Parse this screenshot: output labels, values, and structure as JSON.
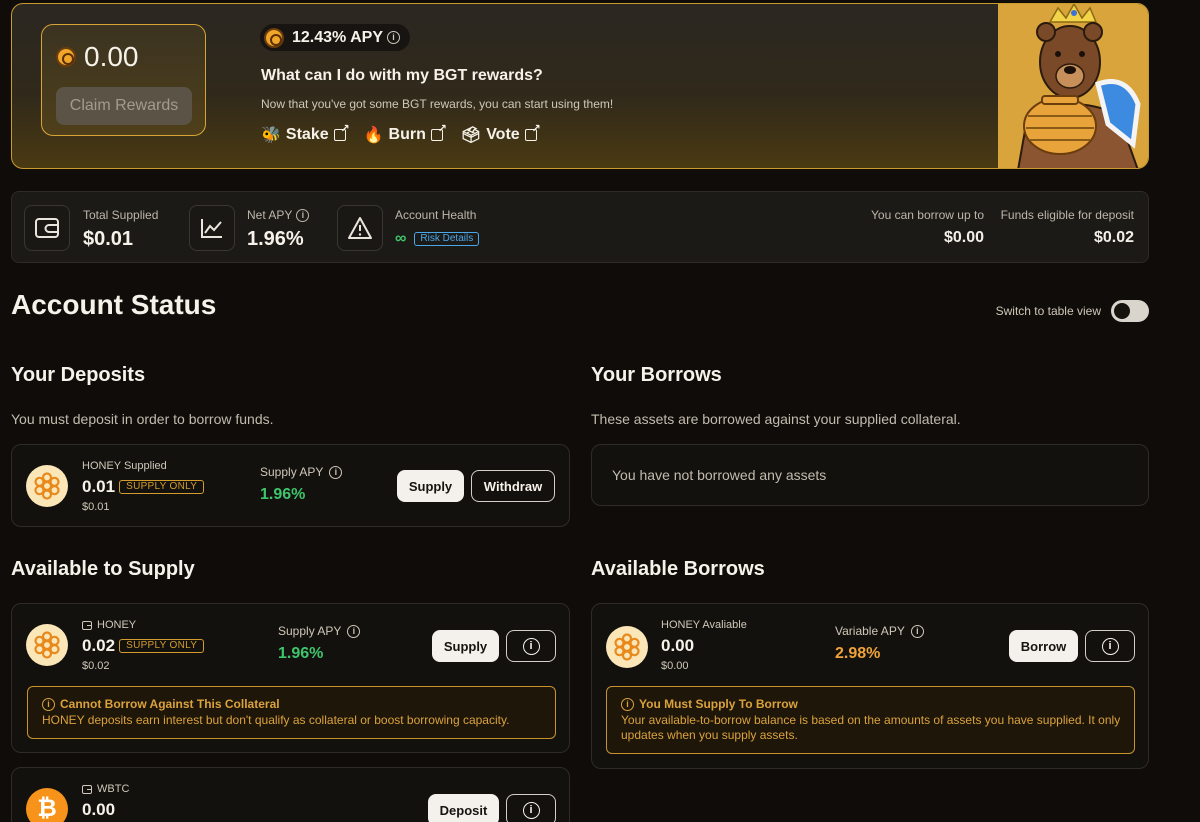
{
  "rewards": {
    "balance": "0.00",
    "claim_label": "Claim Rewards",
    "apy": "12.43% APY",
    "title": "What can I do with my BGT rewards?",
    "subtitle": "Now that you've got some BGT rewards, you can start using them!",
    "links": [
      {
        "emoji": "🐝",
        "label": "Stake"
      },
      {
        "emoji": "🔥",
        "label": "Burn"
      },
      {
        "emoji": "🗳",
        "label": "Vote"
      }
    ]
  },
  "stats": {
    "total_supplied_label": "Total Supplied",
    "total_supplied_value": "$0.01",
    "net_apy_label": "Net APY",
    "net_apy_value": "1.96%",
    "account_health_label": "Account Health",
    "account_health_value": "∞",
    "risk_details_label": "Risk Details",
    "borrow_up_to_label": "You can borrow up to",
    "borrow_up_to_value": "$0.00",
    "funds_eligible_label": "Funds eligible for deposit",
    "funds_eligible_value": "$0.02"
  },
  "account_status": {
    "title": "Account Status",
    "toggle_label": "Switch to table view"
  },
  "deposits": {
    "title": "Your Deposits",
    "subtitle": "You must deposit in order to borrow funds.",
    "item": {
      "label": "HONEY Supplied",
      "amount": "0.01",
      "badge": "SUPPLY ONLY",
      "usd": "$0.01",
      "apy_label": "Supply APY",
      "apy_value": "1.96%",
      "supply_label": "Supply",
      "withdraw_label": "Withdraw"
    }
  },
  "borrows": {
    "title": "Your Borrows",
    "subtitle": "These assets are borrowed against your supplied collateral.",
    "empty_text": "You have not borrowed any assets"
  },
  "available_supply": {
    "title": "Available to Supply",
    "items": [
      {
        "token": "HONEY",
        "amount": "0.02",
        "badge": "SUPPLY ONLY",
        "usd": "$0.02",
        "apy_label": "Supply APY",
        "apy_value": "1.96%",
        "action_label": "Supply",
        "warning_title": "Cannot Borrow Against This Collateral",
        "warning_text": "HONEY deposits earn interest but don't qualify as collateral or boost borrowing capacity."
      },
      {
        "token": "WBTC",
        "amount": "0.00",
        "action_label": "Deposit"
      }
    ]
  },
  "available_borrows": {
    "title": "Available Borrows",
    "item": {
      "label": "HONEY Avaliable",
      "amount": "0.00",
      "usd": "$0.00",
      "apy_label": "Variable APY",
      "apy_value": "2.98%",
      "action_label": "Borrow",
      "warning_title": "You Must Supply To Borrow",
      "warning_text": "Your available-to-borrow balance is based on the amounts of assets you have supplied. It only updates when you supply assets."
    }
  },
  "icons": {
    "bgt": "bgt-coin-icon",
    "wallet": "wallet-icon",
    "chart": "line-chart-icon",
    "warning": "warning-triangle-icon",
    "info": "info-icon",
    "external": "external-link-icon",
    "honey": "honey-token-icon",
    "btc": "bitcoin-icon",
    "wallet_small": "wallet-small-icon"
  },
  "colors": {
    "accent_gold": "#d8a433",
    "apy_green": "#3ec56b",
    "apy_orange": "#f0a33a",
    "risk_blue": "#4aa7e8",
    "background": "#0f0c09"
  }
}
